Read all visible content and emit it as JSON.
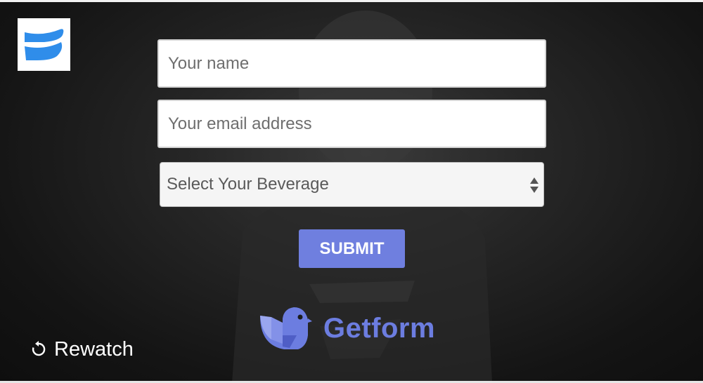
{
  "form": {
    "name_placeholder": "Your name",
    "email_placeholder": "Your email address",
    "beverage_select": "Select Your Beverage",
    "submit_label": "SUBMIT"
  },
  "brand": {
    "name": "Getform",
    "color": "#6c7de0",
    "icon": "getform-bird-logo"
  },
  "player": {
    "rewatch_label": "Rewatch",
    "rewatch_icon": "replay-icon",
    "logo_icon": "wistia-logo"
  },
  "colors": {
    "submit_bg": "#6f7fdf",
    "logo_blue": "#2f8dea"
  }
}
